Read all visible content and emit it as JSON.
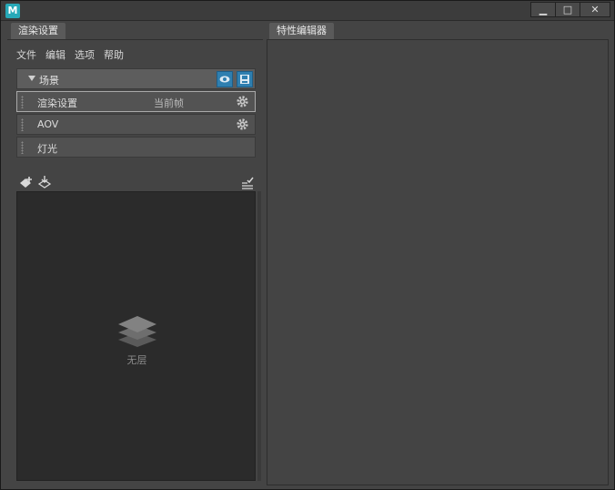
{
  "window": {
    "logo_text": "M",
    "controls": {
      "minimize": "▁",
      "maximize": "□",
      "close": "✕"
    }
  },
  "left_panel": {
    "tab": "渲染设置",
    "menu": [
      "文件",
      "编辑",
      "选项",
      "帮助"
    ],
    "scene": {
      "label": "场景"
    },
    "rows": [
      {
        "label": "渲染设置",
        "sub": "当前帧",
        "gear": true
      },
      {
        "label": "AOV",
        "sub": "",
        "gear": true
      },
      {
        "label": "灯光",
        "sub": "",
        "gear": false
      }
    ],
    "empty_text": "无层"
  },
  "right_panel": {
    "tab": "特性编辑器"
  },
  "colors": {
    "accent": "#2f7fb0",
    "logo": "#27a9b8"
  }
}
